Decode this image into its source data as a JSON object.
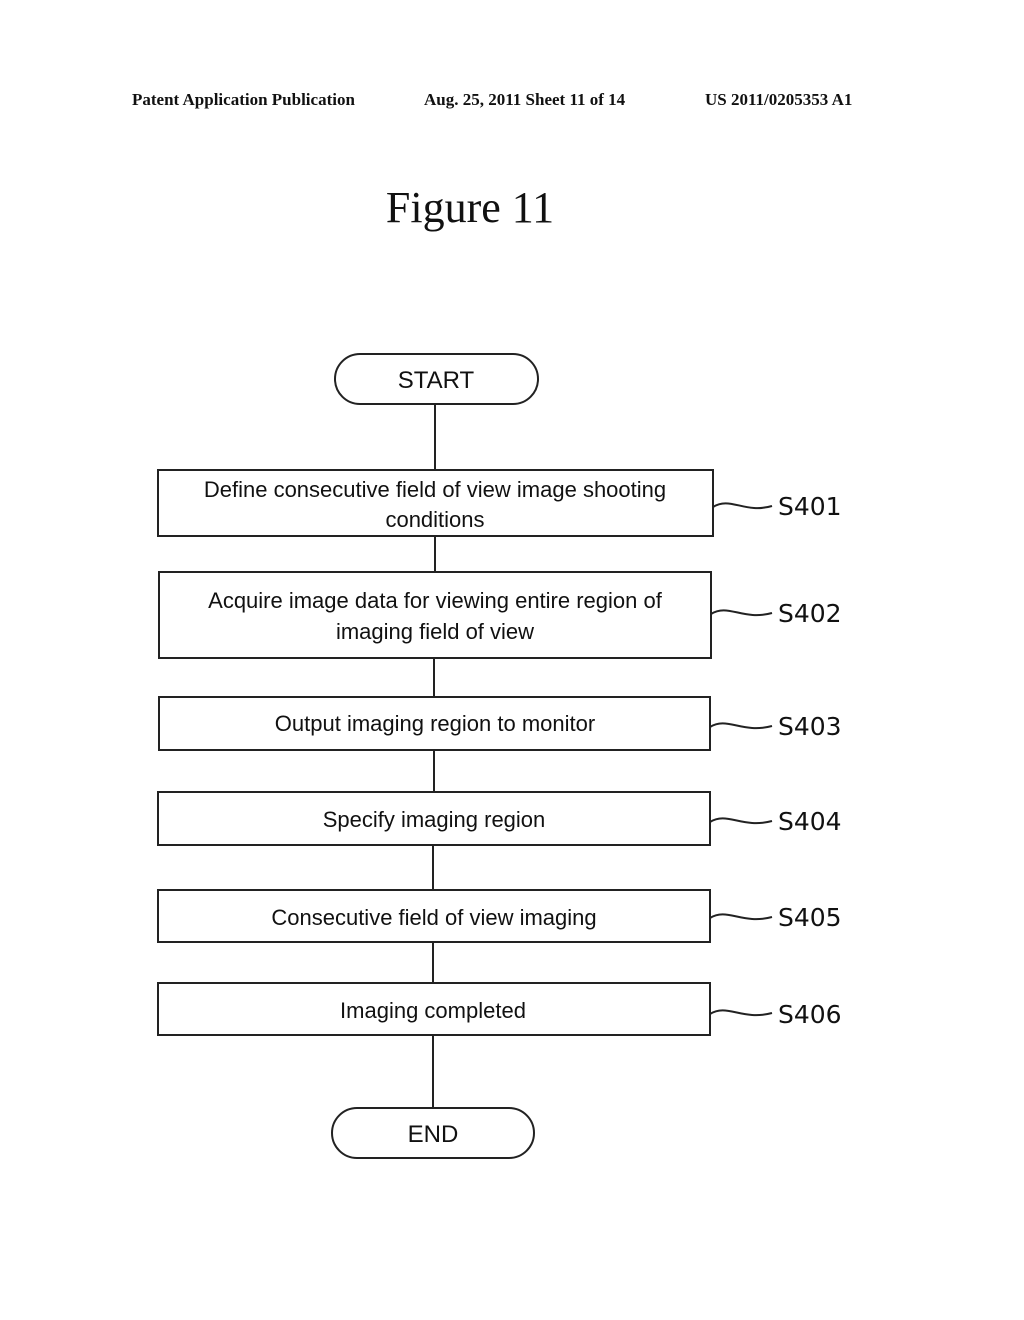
{
  "header": {
    "publication": "Patent Application Publication",
    "date_sheet": "Aug. 25, 2011  Sheet 11 of 14",
    "number": "US 2011/0205353 A1"
  },
  "figure_title": "Figure 11",
  "flowchart": {
    "start": "START",
    "end": "END",
    "steps": [
      {
        "id": "S401",
        "lines": [
          "Define consecutive field of view image shooting",
          "conditions"
        ]
      },
      {
        "id": "S402",
        "lines": [
          "Acquire image data for viewing entire region of",
          "imaging field of view"
        ]
      },
      {
        "id": "S403",
        "lines": [
          "Output imaging region to monitor"
        ]
      },
      {
        "id": "S404",
        "lines": [
          "Specify imaging region"
        ]
      },
      {
        "id": "S405",
        "lines": [
          "Consecutive field of view imaging"
        ]
      },
      {
        "id": "S406",
        "lines": [
          "Imaging completed"
        ]
      }
    ]
  }
}
